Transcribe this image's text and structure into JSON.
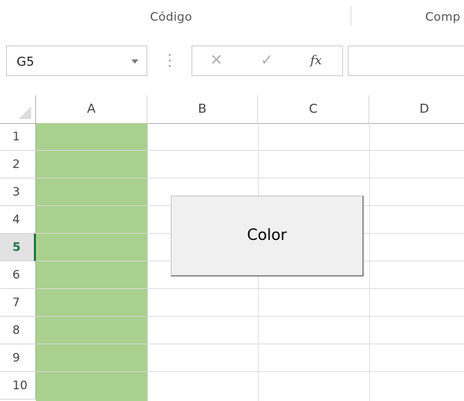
{
  "ribbon": {
    "group_code": "Código",
    "group_comp": "Comp"
  },
  "formula_bar": {
    "name_box_value": "G5",
    "cancel_glyph": "✕",
    "enter_glyph": "✓",
    "function_glyph": "fx",
    "formula_value": ""
  },
  "sheet": {
    "columns": [
      "A",
      "B",
      "C",
      "D"
    ],
    "rows": [
      "1",
      "2",
      "3",
      "4",
      "5",
      "6",
      "7",
      "8",
      "9",
      "10"
    ],
    "active_row": "5",
    "column_a_fill": "#a9d08e",
    "accent": "#217346"
  },
  "button": {
    "label": "Color"
  }
}
